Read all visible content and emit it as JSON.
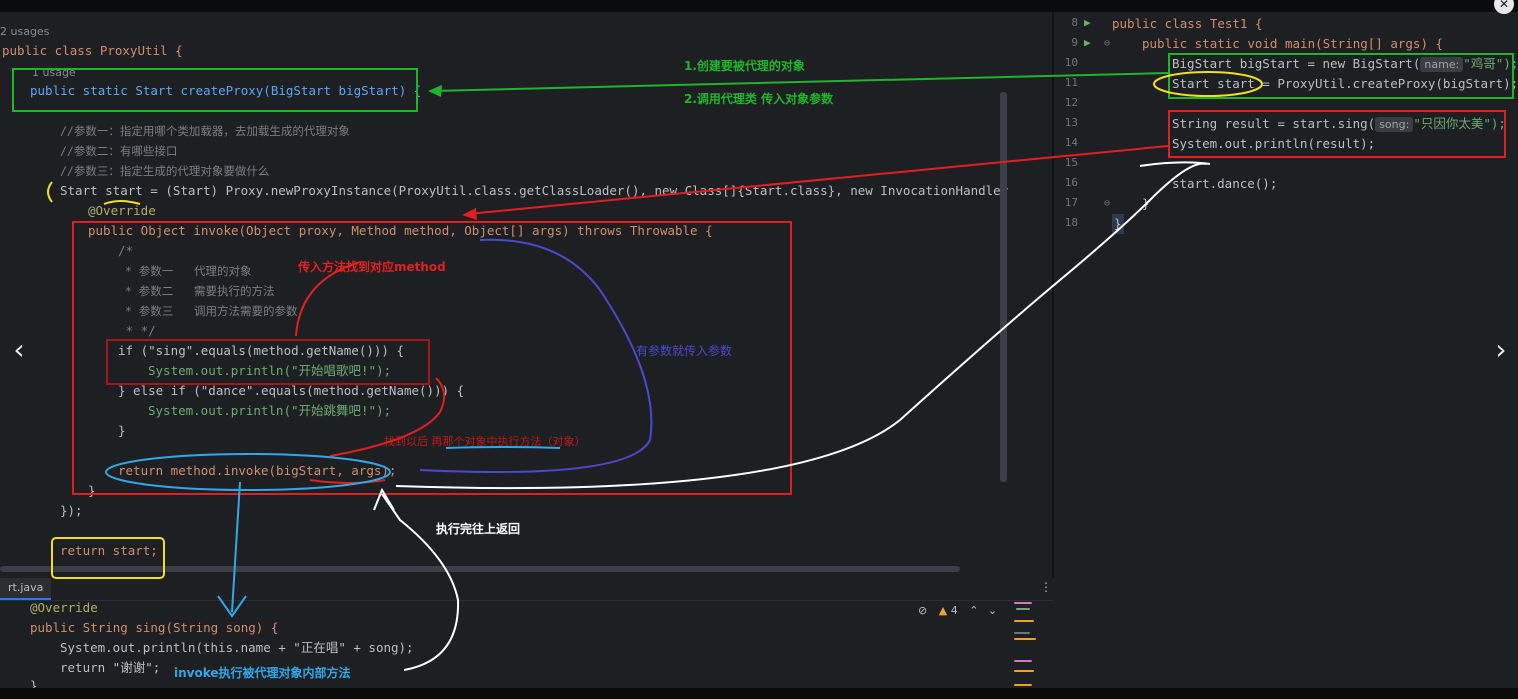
{
  "left_editor": {
    "usages_top": "2 usages",
    "usages_method": "1 usage",
    "line_class": "public class ProxyUtil {",
    "line_method": "public static Start createProxy(BigStart bigStart) {",
    "comment1": "//参数一：指定用哪个类加载器，去加载生成的代理对象",
    "comment2": "//参数二：有哪些接口",
    "comment3": "//参数三：指定生成的代理对象要做什么",
    "line_newproxy": "Start start = (Start) Proxy.newProxyInstance(ProxyUtil.class.getClassLoader(), new Class[]{Start.class}, new InvocationHandler() {",
    "override": "@Override",
    "invoke_sig": "public Object invoke(Object proxy, Method method, Object[] args) throws Throwable {",
    "doc_open": "/*",
    "doc1": " * 参数一   代理的对象",
    "doc2": " * 参数二   需要执行的方法",
    "doc3": " * 参数三   调用方法需要的参数",
    "doc_close": " * */",
    "if_sing": "if (\"sing\".equals(method.getName())) {",
    "print_sing": "System.out.println(\"开始唱歌吧!\");",
    "else_dance": "} else if (\"dance\".equals(method.getName())) {",
    "print_dance": "System.out.println(\"开始跳舞吧!\");",
    "close_brace": "}",
    "return_invoke": "return method.invoke(bigStart, args);",
    "close_brace2": "}",
    "close_paren": "});",
    "return_start": "return start;"
  },
  "right_editor": {
    "line_numbers": [
      "8",
      "9",
      "10",
      "11",
      "12",
      "13",
      "14",
      "15",
      "16",
      "17",
      "18"
    ],
    "l8": "public class Test1 {",
    "l9": "public static void main(String[] args) {",
    "l10_a": "BigStart bigStart = new BigStart(",
    "l10_hint": "name:",
    "l10_b": "\"鸡哥\");",
    "l11": "Start start = ProxyUtil.createProxy(bigStart);",
    "l13_a": "String result = start.sing(",
    "l13_hint": "song:",
    "l13_b": "\"只因你太美\");",
    "l14": "System.out.println(result);",
    "l16": "start.dance();",
    "l17": "}",
    "l18": "}"
  },
  "bottom_editor": {
    "tab_label": "rt.java",
    "override": "@Override",
    "sig": "public String sing(String song) {",
    "print": "System.out.println(this.name + \"正在唱\" + song);",
    "ret": "return \"谢谢\";",
    "close": "}",
    "warnings": "4"
  },
  "annotations": {
    "step1": "1.创建要被代理的对象",
    "step2": "2.调用代理类 传入对象参数",
    "find_method": "传入方法找到对应method",
    "pass_args": "有参数就传入参数",
    "find_exec": "找到以后 再那个对象中执行方法（对象）",
    "return_up": "执行完往上返回",
    "invoke_exec": "invoke执行被代理对象内部方法"
  },
  "colors": {
    "green": "#1fb52b",
    "red": "#e02020",
    "yellow": "#f0e020",
    "blue": "#2fa8e8",
    "purple": "#4a4acf",
    "white": "#ffffff"
  }
}
